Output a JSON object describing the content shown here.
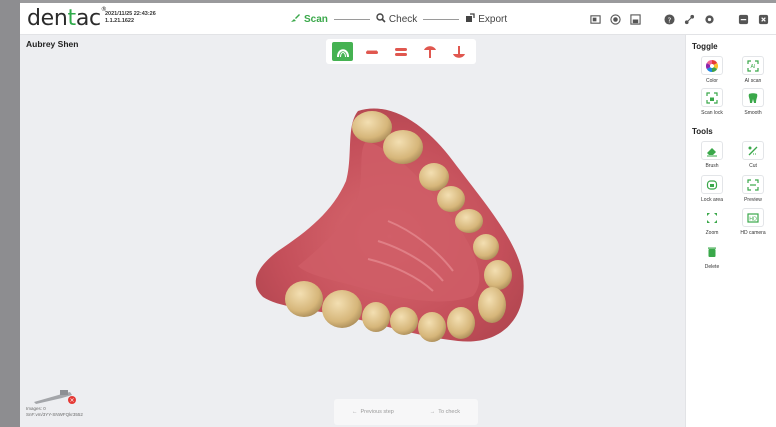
{
  "app": {
    "logo_text_pre": "den",
    "logo_text_accent": "t",
    "logo_text_post": "ac",
    "logo_mark": "®",
    "datetime": "2021/11/25 22:43:26",
    "version": "1.1.21.1622",
    "accent_color": "#3aa84a"
  },
  "workflow": {
    "steps": [
      {
        "label": "Scan",
        "icon": "brush-icon",
        "active": true
      },
      {
        "label": "Check",
        "icon": "magnifier-icon",
        "active": false
      },
      {
        "label": "Export",
        "icon": "export-icon",
        "active": false
      }
    ]
  },
  "toolbar_icons": [
    "screenshot-icon",
    "record-icon",
    "save-icon",
    "help-icon",
    "share-icon",
    "settings-icon",
    "minimize-icon",
    "close-icon"
  ],
  "patient": {
    "name": "Aubrey Shen"
  },
  "view_toolbar": {
    "buttons": [
      "upper-jaw-icon",
      "lower-jaw-icon",
      "bite-icon",
      "implant-icon",
      "scanbody-icon"
    ],
    "active_index": 0
  },
  "status": {
    "images_line": "Images: 0",
    "device_line": "SnF:vm/3YY-SNWFQkr3552"
  },
  "bottom_nav": {
    "previous_label": "Previous step",
    "next_label": "To check"
  },
  "panel": {
    "toggle_title": "Toggle",
    "toggle_items": [
      {
        "label": "Color",
        "icon": "color-wheel-icon"
      },
      {
        "label": "AI scan",
        "icon": "ai-scan-icon"
      },
      {
        "label": "Scan lock",
        "icon": "scan-lock-icon"
      },
      {
        "label": "Smooth",
        "icon": "smooth-tooth-icon"
      }
    ],
    "tools_title": "Tools",
    "tools_items": [
      {
        "label": "Brush",
        "icon": "eraser-icon"
      },
      {
        "label": "Cut",
        "icon": "cut-icon"
      },
      {
        "label": "Lock area",
        "icon": "lock-area-icon"
      },
      {
        "label": "Preview",
        "icon": "preview-icon"
      },
      {
        "label": "Zoom",
        "icon": "zoom-icon"
      },
      {
        "label": "HD camera",
        "icon": "hd-camera-icon"
      },
      {
        "label": "Delete",
        "icon": "trash-icon"
      }
    ]
  }
}
